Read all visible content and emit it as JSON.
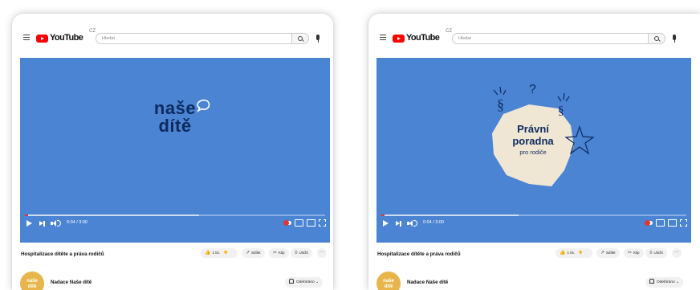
{
  "colors": {
    "player_bg": "#4a84d3",
    "brand_navy": "#0d2a5e",
    "yt_red": "#ff0000",
    "avatar": "#e7b54a",
    "pravni_shape": "#f0e6d4"
  },
  "youtube": {
    "logo_text": "YouTube",
    "region": "CZ",
    "search_placeholder": "Hledat"
  },
  "cards": [
    {
      "player": {
        "time": "0:04 / 3:00",
        "progress": 0.01,
        "buffered": 0.58,
        "brand_line1": "naše",
        "brand_line2": "dítě"
      },
      "title": "Hospitalizace dítěte a práva rodičů",
      "actions": {
        "likes": "1 tis.",
        "share": "Sdílet",
        "clip": "Klip",
        "save": "Uložit",
        "more": "···"
      },
      "channel": {
        "avatar_line1": "naše",
        "avatar_line2": "dítě",
        "name": "Nadace Naše dítě",
        "subscribed": "Odebíráno"
      }
    },
    {
      "player": {
        "time": "0:04 / 3:00",
        "progress": 0.01,
        "buffered": 0.45,
        "pravni": "Právní",
        "poradna": "poradna",
        "pro_rodice": "pro rodiče"
      },
      "title": "Hospitalizace dítěte a práva rodičů",
      "actions": {
        "likes": "1 tis.",
        "share": "Sdílet",
        "clip": "Klip",
        "save": "Uložit",
        "more": "···"
      },
      "channel": {
        "avatar_line1": "naše",
        "avatar_line2": "dítě",
        "name": "Nadace Naše dítě",
        "subscribed": "Odebíráno"
      }
    }
  ]
}
